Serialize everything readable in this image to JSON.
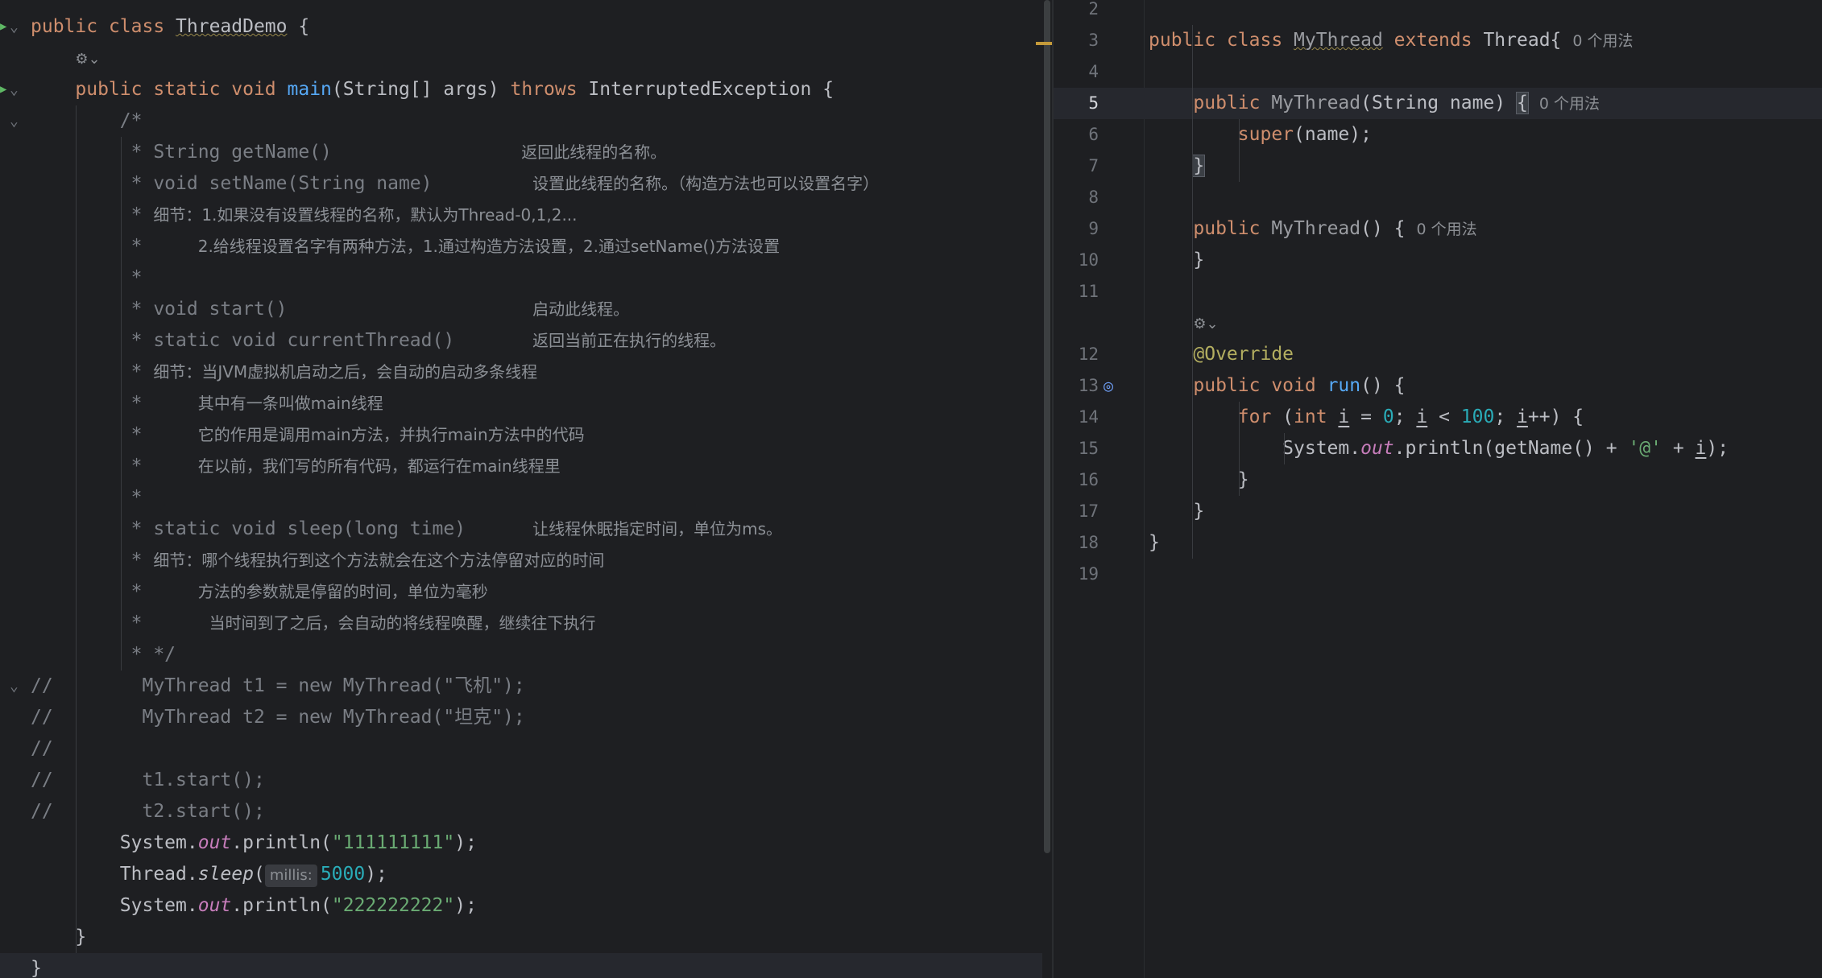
{
  "left_editor": {
    "lines": [
      {
        "id": "l1",
        "parts": [
          {
            "t": "public ",
            "c": "kw"
          },
          {
            "t": "class ",
            "c": "kw"
          },
          {
            "t": "ThreadDemo",
            "c": "cls-def"
          },
          {
            "t": " {",
            "c": ""
          }
        ]
      },
      {
        "id": "l2",
        "parts": [
          {
            "t": "    ",
            "c": ""
          },
          {
            "t": "⚙⌄",
            "c": "ai-icon"
          }
        ]
      },
      {
        "id": "l3",
        "parts": [
          {
            "t": "    ",
            "c": ""
          },
          {
            "t": "public ",
            "c": "kw"
          },
          {
            "t": "static ",
            "c": "kw"
          },
          {
            "t": "void ",
            "c": "kw"
          },
          {
            "t": "main",
            "c": "fn"
          },
          {
            "t": "(String[] args) ",
            "c": ""
          },
          {
            "t": "throws ",
            "c": "kw"
          },
          {
            "t": "InterruptedException {",
            "c": ""
          }
        ]
      },
      {
        "id": "l4",
        "parts": [
          {
            "t": "        /*",
            "c": "cmt"
          }
        ]
      },
      {
        "id": "l5",
        "parts": [
          {
            "t": "         * String getName()                 ",
            "c": "cmt"
          },
          {
            "t": "返回此线程的名称。",
            "c": "cmt-cn"
          }
        ]
      },
      {
        "id": "l6",
        "parts": [
          {
            "t": "         * void setName(String name)         ",
            "c": "cmt"
          },
          {
            "t": "设置此线程的名称。（构造方法也可以设置名字）",
            "c": "cmt-cn"
          }
        ]
      },
      {
        "id": "l7",
        "parts": [
          {
            "t": "         * ",
            "c": "cmt"
          },
          {
            "t": "细节：1.如果没有设置线程的名称，默认为Thread-0,1,2...",
            "c": "cmt-cn"
          }
        ]
      },
      {
        "id": "l8",
        "parts": [
          {
            "t": "         *     ",
            "c": "cmt"
          },
          {
            "t": "2.给线程设置名字有两种方法，1.通过构造方法设置，2.通过setName()方法设置",
            "c": "cmt-cn"
          }
        ]
      },
      {
        "id": "l9",
        "parts": [
          {
            "t": "         *",
            "c": "cmt"
          }
        ]
      },
      {
        "id": "l10",
        "parts": [
          {
            "t": "         * void start()                      ",
            "c": "cmt"
          },
          {
            "t": "启动此线程。",
            "c": "cmt-cn"
          }
        ]
      },
      {
        "id": "l11",
        "parts": [
          {
            "t": "         * static void currentThread()       ",
            "c": "cmt"
          },
          {
            "t": "返回当前正在执行的线程。",
            "c": "cmt-cn"
          }
        ]
      },
      {
        "id": "l12",
        "parts": [
          {
            "t": "         * ",
            "c": "cmt"
          },
          {
            "t": "细节：当JVM虚拟机启动之后，会自动的启动多条线程",
            "c": "cmt-cn"
          }
        ]
      },
      {
        "id": "l13",
        "parts": [
          {
            "t": "         *     ",
            "c": "cmt"
          },
          {
            "t": "其中有一条叫做main线程",
            "c": "cmt-cn"
          }
        ]
      },
      {
        "id": "l14",
        "parts": [
          {
            "t": "         *     ",
            "c": "cmt"
          },
          {
            "t": "它的作用是调用main方法，并执行main方法中的代码",
            "c": "cmt-cn"
          }
        ]
      },
      {
        "id": "l15",
        "parts": [
          {
            "t": "         *     ",
            "c": "cmt"
          },
          {
            "t": "在以前，我们写的所有代码，都运行在main线程里",
            "c": "cmt-cn"
          }
        ]
      },
      {
        "id": "l16",
        "parts": [
          {
            "t": "         *",
            "c": "cmt"
          }
        ]
      },
      {
        "id": "l17",
        "parts": [
          {
            "t": "         * static void sleep(long time)      ",
            "c": "cmt"
          },
          {
            "t": "让线程休眠指定时间，单位为ms。",
            "c": "cmt-cn"
          }
        ]
      },
      {
        "id": "l18",
        "parts": [
          {
            "t": "         * ",
            "c": "cmt"
          },
          {
            "t": "细节：哪个线程执行到这个方法就会在这个方法停留对应的时间",
            "c": "cmt-cn"
          }
        ]
      },
      {
        "id": "l19",
        "parts": [
          {
            "t": "         *     ",
            "c": "cmt"
          },
          {
            "t": "方法的参数就是停留的时间，单位为毫秒",
            "c": "cmt-cn"
          }
        ]
      },
      {
        "id": "l20",
        "parts": [
          {
            "t": "         *      ",
            "c": "cmt"
          },
          {
            "t": "当时间到了之后，会自动的将线程唤醒，继续往下执行",
            "c": "cmt-cn"
          }
        ]
      },
      {
        "id": "l21",
        "parts": [
          {
            "t": "         * */",
            "c": "cmt"
          }
        ]
      },
      {
        "id": "l22",
        "parts": [
          {
            "t": "//        MyThread t1 = new MyThread(\"飞机\");",
            "c": "cmt"
          }
        ]
      },
      {
        "id": "l23",
        "parts": [
          {
            "t": "//        MyThread t2 = new MyThread(\"坦克\");",
            "c": "cmt"
          }
        ]
      },
      {
        "id": "l24",
        "parts": [
          {
            "t": "//",
            "c": "cmt"
          }
        ]
      },
      {
        "id": "l25",
        "parts": [
          {
            "t": "//        t1.start();",
            "c": "cmt"
          }
        ]
      },
      {
        "id": "l26",
        "parts": [
          {
            "t": "//        t2.start();",
            "c": "cmt"
          }
        ]
      },
      {
        "id": "l27",
        "parts": [
          {
            "t": "        System.",
            "c": ""
          },
          {
            "t": "out",
            "c": "field"
          },
          {
            "t": ".println(",
            "c": ""
          },
          {
            "t": "\"111111111\"",
            "c": "str"
          },
          {
            "t": ");",
            "c": ""
          }
        ]
      },
      {
        "id": "l28",
        "parts": [
          {
            "t": "        Thread.",
            "c": ""
          },
          {
            "t": "sleep",
            "c": "static-m"
          },
          {
            "t": "(",
            "c": ""
          },
          {
            "t": "millis:",
            "c": "hint"
          },
          {
            "t": "5000",
            "c": "num"
          },
          {
            "t": ");",
            "c": ""
          }
        ]
      },
      {
        "id": "l29",
        "parts": [
          {
            "t": "        System.",
            "c": ""
          },
          {
            "t": "out",
            "c": "field"
          },
          {
            "t": ".println(",
            "c": ""
          },
          {
            "t": "\"222222222\"",
            "c": "str"
          },
          {
            "t": ");",
            "c": ""
          }
        ]
      },
      {
        "id": "l30",
        "parts": [
          {
            "t": "    }",
            "c": ""
          }
        ]
      },
      {
        "id": "l31",
        "parts": [
          {
            "t": "}",
            "c": ""
          }
        ]
      }
    ]
  },
  "right_editor": {
    "lines": [
      {
        "n": "2",
        "parts": []
      },
      {
        "n": "3",
        "parts": [
          {
            "t": "public ",
            "c": "kw"
          },
          {
            "t": "class ",
            "c": "kw"
          },
          {
            "t": "MyThread",
            "c": "cls-def unused"
          },
          {
            "t": " ",
            "c": ""
          },
          {
            "t": "extends ",
            "c": "kw"
          },
          {
            "t": "Thread{",
            "c": ""
          },
          {
            "t": "0 个用法",
            "c": "usage"
          }
        ]
      },
      {
        "n": "4",
        "parts": []
      },
      {
        "n": "5",
        "parts": [
          {
            "t": "    ",
            "c": ""
          },
          {
            "t": "public ",
            "c": "kw"
          },
          {
            "t": "MyThread",
            "c": "unused"
          },
          {
            "t": "(String name) ",
            "c": ""
          },
          {
            "t": "{",
            "c": "brace-hl"
          },
          {
            "t": "0 个用法",
            "c": "usage"
          }
        ]
      },
      {
        "n": "6",
        "parts": [
          {
            "t": "        ",
            "c": ""
          },
          {
            "t": "super",
            "c": "kw"
          },
          {
            "t": "(name);",
            "c": ""
          }
        ]
      },
      {
        "n": "7",
        "parts": [
          {
            "t": "    ",
            "c": ""
          },
          {
            "t": "}",
            "c": "brace-hl"
          }
        ]
      },
      {
        "n": "8",
        "parts": []
      },
      {
        "n": "9",
        "parts": [
          {
            "t": "    ",
            "c": ""
          },
          {
            "t": "public ",
            "c": "kw"
          },
          {
            "t": "MyThread",
            "c": "unused"
          },
          {
            "t": "() {",
            "c": ""
          },
          {
            "t": "0 个用法",
            "c": "usage"
          }
        ]
      },
      {
        "n": "10",
        "parts": [
          {
            "t": "    }",
            "c": ""
          }
        ]
      },
      {
        "n": "11",
        "parts": []
      },
      {
        "n": "",
        "parts": [
          {
            "t": "    ",
            "c": ""
          },
          {
            "t": "⚙⌄",
            "c": "ai-icon"
          }
        ]
      },
      {
        "n": "12",
        "parts": [
          {
            "t": "    ",
            "c": ""
          },
          {
            "t": "@Override",
            "c": "ann"
          }
        ]
      },
      {
        "n": "13",
        "parts": [
          {
            "t": "    ",
            "c": ""
          },
          {
            "t": "public ",
            "c": "kw"
          },
          {
            "t": "void ",
            "c": "kw"
          },
          {
            "t": "run",
            "c": "fn"
          },
          {
            "t": "() {",
            "c": ""
          }
        ]
      },
      {
        "n": "14",
        "parts": [
          {
            "t": "        ",
            "c": ""
          },
          {
            "t": "for ",
            "c": "kw"
          },
          {
            "t": "(",
            "c": ""
          },
          {
            "t": "int ",
            "c": "kw"
          },
          {
            "t": "i",
            "c": "var-u"
          },
          {
            "t": " = ",
            "c": ""
          },
          {
            "t": "0",
            "c": "num"
          },
          {
            "t": "; ",
            "c": ""
          },
          {
            "t": "i",
            "c": "var-u"
          },
          {
            "t": " < ",
            "c": ""
          },
          {
            "t": "100",
            "c": "num"
          },
          {
            "t": "; ",
            "c": ""
          },
          {
            "t": "i",
            "c": "var-u"
          },
          {
            "t": "++) {",
            "c": ""
          }
        ]
      },
      {
        "n": "15",
        "parts": [
          {
            "t": "            System.",
            "c": ""
          },
          {
            "t": "out",
            "c": "field"
          },
          {
            "t": ".println(getName() + ",
            "c": ""
          },
          {
            "t": "'@'",
            "c": "str"
          },
          {
            "t": " + ",
            "c": ""
          },
          {
            "t": "i",
            "c": "var-u"
          },
          {
            "t": ");",
            "c": ""
          }
        ]
      },
      {
        "n": "16",
        "parts": [
          {
            "t": "        }",
            "c": ""
          }
        ]
      },
      {
        "n": "17",
        "parts": [
          {
            "t": "    }",
            "c": ""
          }
        ]
      },
      {
        "n": "18",
        "parts": [
          {
            "t": "}",
            "c": ""
          }
        ]
      },
      {
        "n": "19",
        "parts": []
      }
    ]
  },
  "colors": {
    "background": "#1e1f22",
    "keyword": "#cf8e6d",
    "function": "#56a8f5",
    "string": "#6aab73",
    "number": "#2aacb8",
    "comment": "#7a7e85",
    "field": "#c77dbb",
    "annotation": "#b3ae60"
  },
  "icons": {
    "run": "run-arrow-icon",
    "fold": "fold-chevron-icon",
    "ai": "ai-assistant-icon",
    "implements": "override-implements-icon"
  }
}
